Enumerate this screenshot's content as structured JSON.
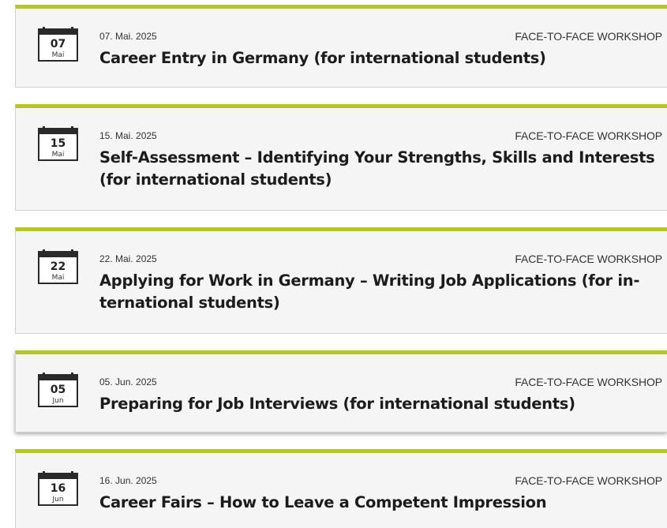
{
  "events": [
    {
      "day": "07",
      "month": "Mai",
      "date": "07. Mai. 2025",
      "type": "FACE-TO-FACE WORKSHOP",
      "title": "Career Entry in Germany (for international students)"
    },
    {
      "day": "15",
      "month": "Mai",
      "date": "15. Mai. 2025",
      "type": "FACE-TO-FACE WORKSHOP",
      "title": "Self-Assessment – Identifying Your Strengths, Skills and Interests (for international students)"
    },
    {
      "day": "22",
      "month": "Mai",
      "date": "22. Mai. 2025",
      "type": "FACE-TO-FACE WORKSHOP",
      "title": "Applying for Work in Germany – Writing Job Applications (for in-ternational students)"
    },
    {
      "day": "05",
      "month": "Jun",
      "date": "05. Jun. 2025",
      "type": "FACE-TO-FACE WORKSHOP",
      "title": "Preparing for Job Interviews (for international students)"
    },
    {
      "day": "16",
      "month": "Jun",
      "date": "16. Jun. 2025",
      "type": "FACE-TO-FACE WORKSHOP",
      "title": "Career Fairs – How to Leave a Competent Impression"
    }
  ],
  "colors": {
    "accent": "#b5c81f",
    "card_background": "#f5f5f5",
    "text": "#1c1c1c"
  }
}
